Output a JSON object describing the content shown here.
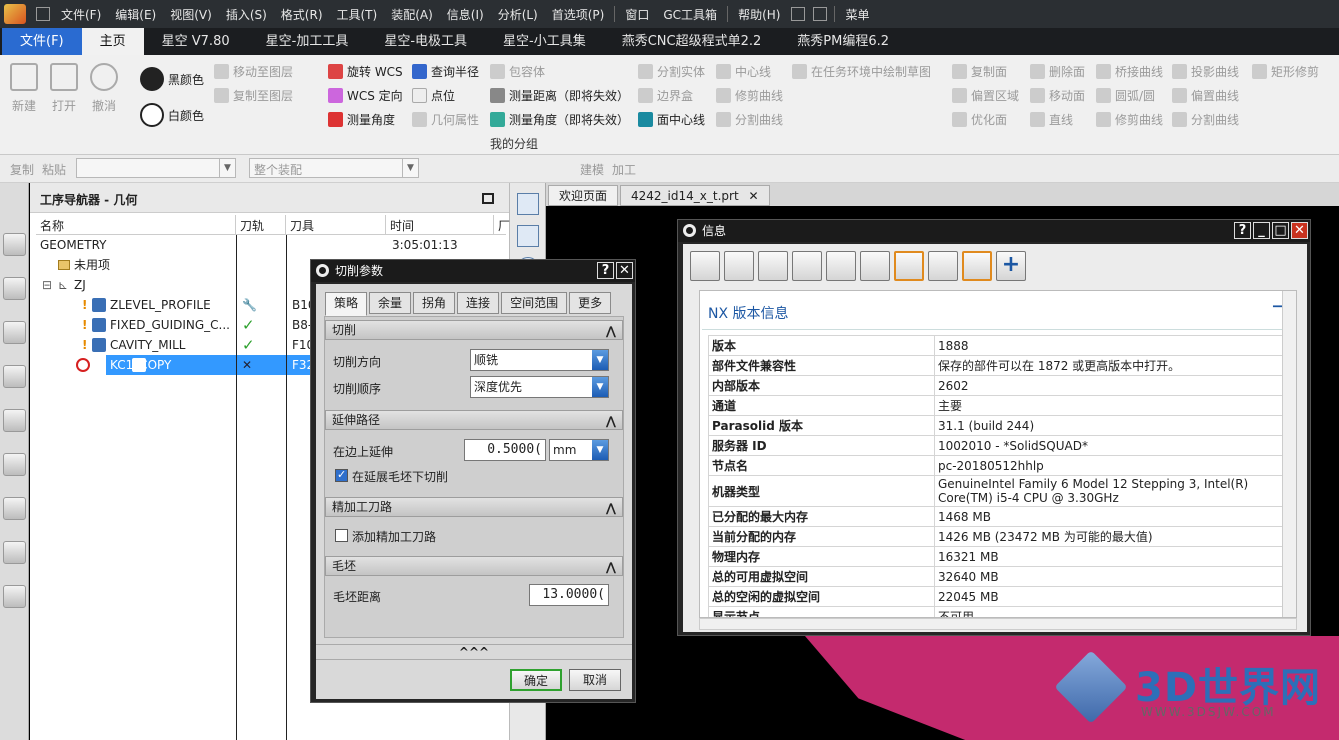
{
  "menu": {
    "items": [
      "文件(F)",
      "编辑(E)",
      "视图(V)",
      "插入(S)",
      "格式(R)",
      "工具(T)",
      "装配(A)",
      "信息(I)",
      "分析(L)",
      "首选项(P)",
      "窗口",
      "GC工具箱",
      "帮助(H)",
      "菜单"
    ]
  },
  "ribbon_tabs": [
    "文件(F)",
    "主页",
    "星空 V7.80",
    "星空-加工工具",
    "星空-电极工具",
    "星空-小工具集",
    "燕秀CNC超级程式单2.2",
    "燕秀PM编程6.2"
  ],
  "ribbon": {
    "big": [
      "新建",
      "打开",
      "撤消"
    ],
    "col1": [
      "黑颜色",
      "白颜色"
    ],
    "col2": [
      "移动至图层",
      "复制至图层"
    ],
    "col3": [
      "旋转 WCS",
      "WCS 定向",
      "测量角度"
    ],
    "col4": [
      "查询半径",
      "点位",
      "几何属性"
    ],
    "col5": [
      "包容体",
      "测量距离（即将失效）",
      "测量角度（即将失效）"
    ],
    "col6": [
      "分割实体",
      "边界盒",
      "面中心线"
    ],
    "col7": [
      "中心线",
      "修剪曲线",
      "分割曲线"
    ],
    "col8": [
      "在任务环境中绘制草图"
    ],
    "col9": [
      "复制面",
      "偏置区域",
      "优化面"
    ],
    "col10": [
      "删除面",
      "移动面",
      "直线"
    ],
    "col11": [
      "桥接曲线",
      "圆弧/圆",
      "修剪曲线"
    ],
    "col12": [
      "投影曲线",
      "偏置曲线",
      "分割曲线"
    ],
    "col13": [
      "矩形修剪"
    ],
    "group_label": "我的分组"
  },
  "toolbar2": {
    "copy": "复制",
    "paste": "粘贴",
    "combo2": "整个装配",
    "build": "建模",
    "machining": "加工"
  },
  "navigator": {
    "title": "工序导航器 - 几何",
    "columns": [
      "名称",
      "刀轨",
      "刀具",
      "时间",
      "厂"
    ],
    "rows": [
      {
        "name": "GEOMETRY",
        "path": "",
        "tool": "",
        "time": "3:05:01:13"
      },
      {
        "name": "未用项",
        "path": "",
        "tool": "",
        "time": ""
      },
      {
        "name": "ZJ",
        "path": "",
        "tool": "",
        "time": ""
      },
      {
        "name": "ZLEVEL_PROFILE",
        "path": "wrench",
        "tool": "B10",
        "time": ""
      },
      {
        "name": "FIXED_GUIDING_C...",
        "path": "✓",
        "tool": "B8-",
        "time": ""
      },
      {
        "name": "CAVITY_MILL",
        "path": "✓",
        "tool": "F10",
        "time": ""
      },
      {
        "name": "KC1_COPY",
        "path": "✕",
        "tool": "F32",
        "time": ""
      }
    ]
  },
  "graphics_tabs": [
    "欢迎页面",
    "4242_id14_x_t.prt"
  ],
  "cut_dialog": {
    "title": "切削参数",
    "tabs": [
      "策略",
      "余量",
      "拐角",
      "连接",
      "空间范围",
      "更多"
    ],
    "sections": {
      "cut": "切削",
      "extend": "延伸路径",
      "finish": "精加工刀路",
      "blank": "毛坯"
    },
    "fields": {
      "cut_direction_label": "切削方向",
      "cut_direction": "顺铣",
      "cut_order_label": "切削顺序",
      "cut_order": "深度优先",
      "extend_label": "在边上延伸",
      "extend_value": "0.5000(",
      "extend_unit": "mm",
      "extend_check": "在延展毛坯下切削",
      "finish_check": "添加精加工刀路",
      "blank_label": "毛坯距离",
      "blank_value": "13.0000("
    },
    "ok": "确定",
    "cancel": "取消",
    "expand": "^^^"
  },
  "info_dialog": {
    "title": "信息",
    "section": "NX 版本信息",
    "rows": [
      [
        "版本",
        "1888"
      ],
      [
        "部件文件兼容性",
        "保存的部件可以在 1872 或更高版本中打开。"
      ],
      [
        "内部版本",
        "2602"
      ],
      [
        "通道",
        "主要"
      ],
      [
        "Parasolid 版本",
        "31.1 (build 244)"
      ],
      [
        "服务器 ID",
        "1002010 - *SolidSQUAD*"
      ],
      [
        "节点名",
        "pc-20180512hhlp"
      ],
      [
        "机器类型",
        "GenuineIntel Family 6 Model 12 Stepping 3, Intel(R) Core(TM) i5-4 CPU @ 3.30GHz"
      ],
      [
        "已分配的最大内存",
        "1468 MB"
      ],
      [
        "当前分配的内存",
        "1426 MB (23472 MB 为可能的最大值)"
      ],
      [
        "物理内存",
        "16321 MB"
      ],
      [
        "总的可用虚拟空间",
        "32640 MB"
      ],
      [
        "总的空闲的虚拟空间",
        "22045 MB"
      ],
      [
        "显示节点",
        "不可用"
      ]
    ]
  },
  "watermark": {
    "brand": "3D世界网",
    "url": "WWW.3DSJW.COM"
  },
  "colors": {
    "accent": "#3399ff",
    "file_tab": "#2a6bd1",
    "check": "#2fa12f",
    "error": "#d62020"
  }
}
